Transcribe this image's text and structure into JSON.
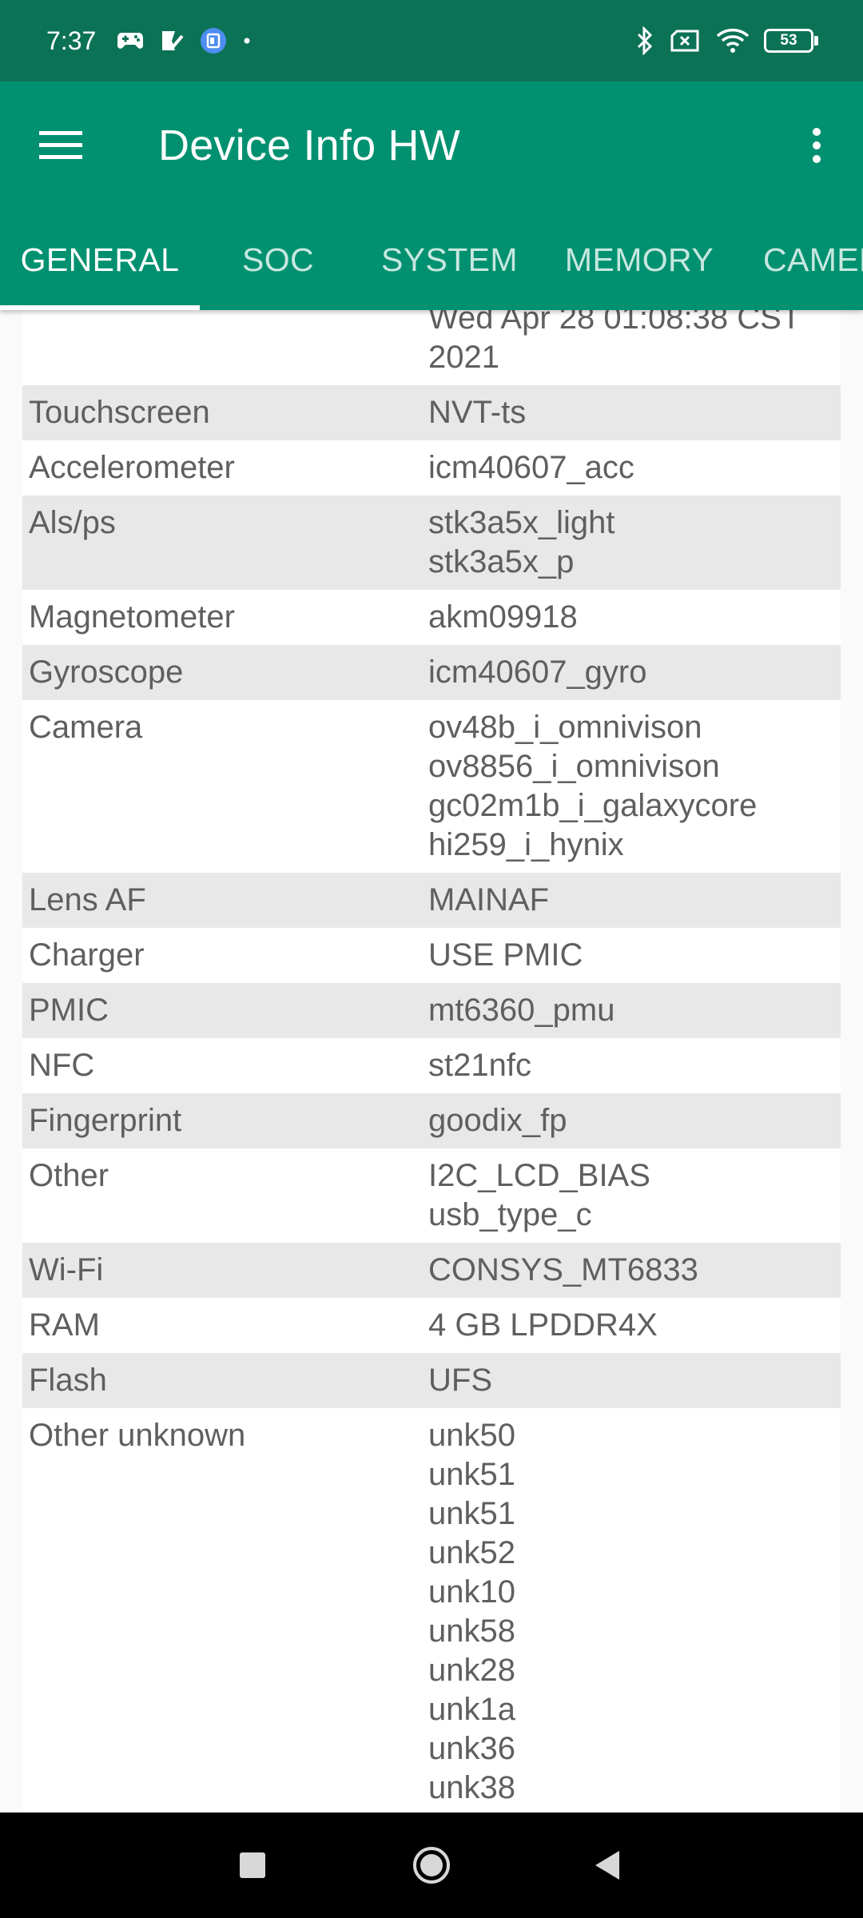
{
  "status_bar": {
    "time": "7:37",
    "left_icons": [
      "game-controller-icon",
      "clipboard-check-icon",
      "app-notification-icon",
      "dot-icon"
    ],
    "right_icons": [
      "bluetooth-icon",
      "sim-x-icon",
      "wifi-icon"
    ],
    "battery": "53"
  },
  "app_bar": {
    "title": "Device Info HW",
    "background": "#019170"
  },
  "tabs": [
    {
      "label": "GENERAL",
      "active": true
    },
    {
      "label": "SOC"
    },
    {
      "label": "SYSTEM"
    },
    {
      "label": "MEMORY"
    },
    {
      "label": "CAMERA"
    }
  ],
  "rows": [
    {
      "label": "",
      "values": [
        "Wed Apr 28 01:08:38 CST",
        "2021"
      ]
    },
    {
      "label": "Touchscreen",
      "values": [
        "NVT-ts"
      ]
    },
    {
      "label": "Accelerometer",
      "values": [
        "icm40607_acc"
      ]
    },
    {
      "label": "Als/ps",
      "values": [
        "stk3a5x_light",
        "stk3a5x_p"
      ]
    },
    {
      "label": "Magnetometer",
      "values": [
        "akm09918"
      ]
    },
    {
      "label": "Gyroscope",
      "values": [
        "icm40607_gyro"
      ]
    },
    {
      "label": "Camera",
      "values": [
        "ov48b_i_omnivison",
        "ov8856_i_omnivison",
        "gc02m1b_i_galaxycore",
        "hi259_i_hynix"
      ]
    },
    {
      "label": "Lens AF",
      "values": [
        "MAINAF"
      ]
    },
    {
      "label": "Charger",
      "values": [
        "USE PMIC"
      ]
    },
    {
      "label": "PMIC",
      "values": [
        "mt6360_pmu"
      ]
    },
    {
      "label": "NFC",
      "values": [
        "st21nfc"
      ]
    },
    {
      "label": "Fingerprint",
      "values": [
        "goodix_fp"
      ]
    },
    {
      "label": "Other",
      "values": [
        "I2C_LCD_BIAS",
        "usb_type_c"
      ]
    },
    {
      "label": "Wi-Fi",
      "values": [
        "CONSYS_MT6833"
      ]
    },
    {
      "label": "RAM",
      "values": [
        "4 GB LPDDR4X"
      ]
    },
    {
      "label": "Flash",
      "values": [
        "UFS"
      ]
    },
    {
      "label": "Other unknown",
      "values": [
        "unk50",
        "unk51",
        "unk51",
        "unk52",
        "unk10",
        "unk58",
        "unk28",
        "unk1a",
        "unk36",
        "unk38"
      ]
    }
  ],
  "nav_bar": {
    "buttons": [
      "recents-square-icon",
      "home-circle-icon",
      "back-triangle-icon"
    ]
  }
}
